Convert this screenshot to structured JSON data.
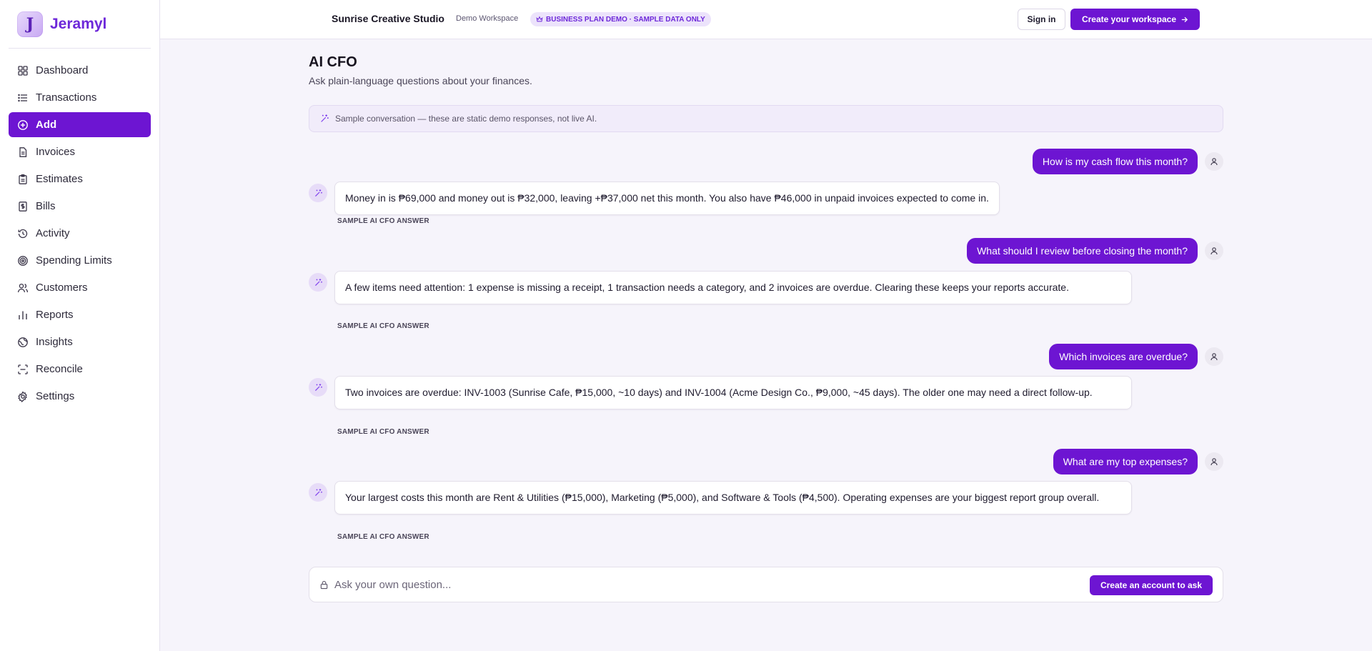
{
  "brand": {
    "name": "Jeramyl",
    "logo_letter": "J"
  },
  "sidebar": {
    "items": [
      {
        "label": "Dashboard",
        "icon": "grid-icon"
      },
      {
        "label": "Transactions",
        "icon": "list-icon"
      },
      {
        "label": "Add",
        "icon": "plus-circle-icon",
        "active": true
      },
      {
        "label": "Invoices",
        "icon": "file-icon"
      },
      {
        "label": "Estimates",
        "icon": "clipboard-icon"
      },
      {
        "label": "Bills",
        "icon": "receipt-icon"
      },
      {
        "label": "Activity",
        "icon": "history-icon"
      },
      {
        "label": "Spending Limits",
        "icon": "target-icon"
      },
      {
        "label": "Customers",
        "icon": "users-icon"
      },
      {
        "label": "Reports",
        "icon": "bar-chart-icon"
      },
      {
        "label": "Insights",
        "icon": "globe-icon"
      },
      {
        "label": "Reconcile",
        "icon": "scan-icon"
      },
      {
        "label": "Settings",
        "icon": "gear-icon"
      }
    ]
  },
  "topbar": {
    "title": "Sunrise Creative Studio",
    "workspace": "Demo Workspace",
    "badge": "BUSINESS PLAN DEMO · SAMPLE DATA ONLY",
    "sign_in": "Sign in",
    "create_workspace": "Create your workspace"
  },
  "page": {
    "title": "AI CFO",
    "subtitle": "Ask plain-language questions about your finances.",
    "notice": "Sample conversation — these are static demo responses, not live AI."
  },
  "conversation": [
    {
      "question": "How is my cash flow this month?",
      "answer": "Money in is ₱69,000 and money out is ₱32,000, leaving +₱37,000 net this month. You also have ₱46,000 in unpaid invoices expected to come in.",
      "caption": "SAMPLE AI CFO ANSWER"
    },
    {
      "question": "What should I review before closing the month?",
      "answer": "A few items need attention: 1 expense is missing a receipt, 1 transaction needs a category, and 2 invoices are overdue. Clearing these keeps your reports accurate.",
      "caption": "SAMPLE AI CFO ANSWER"
    },
    {
      "question": "Which invoices are overdue?",
      "answer": "Two invoices are overdue: INV-1003 (Sunrise Cafe, ₱15,000, ~10 days) and INV-1004 (Acme Design Co., ₱9,000, ~45 days). The older one may need a direct follow-up.",
      "caption": "SAMPLE AI CFO ANSWER"
    },
    {
      "question": "What are my top expenses?",
      "answer": "Your largest costs this month are Rent & Utilities (₱15,000), Marketing (₱5,000), and Software & Tools (₱4,500). Operating expenses are your biggest report group overall.",
      "caption": "SAMPLE AI CFO ANSWER"
    }
  ],
  "ask": {
    "placeholder": "Ask your own question...",
    "button": "Create an account to ask"
  },
  "colors": {
    "accent": "#6d15d2",
    "background": "#f6f4fb"
  }
}
